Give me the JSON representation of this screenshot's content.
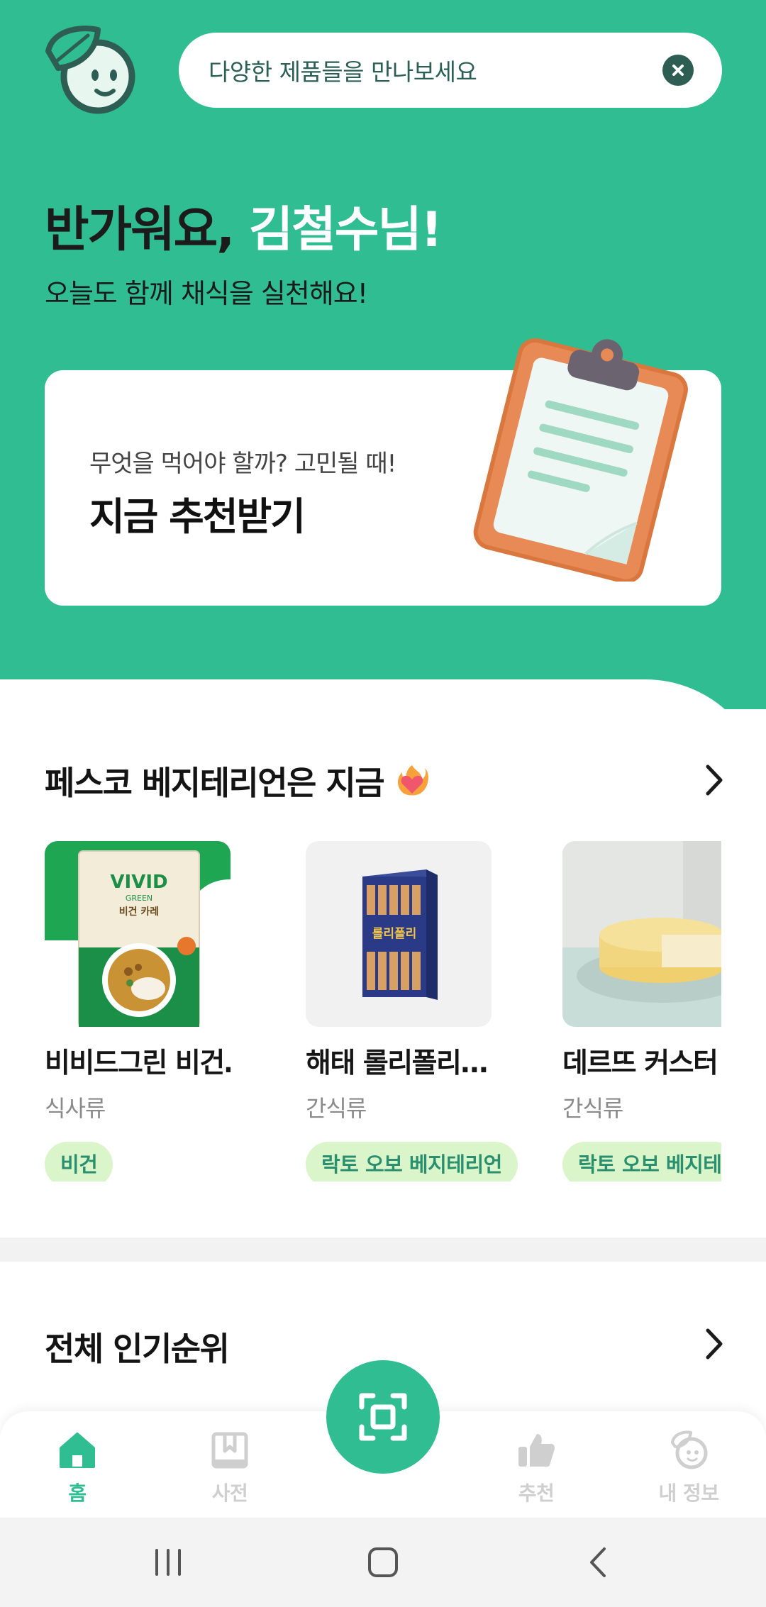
{
  "header": {
    "search_placeholder": "다양한 제품들을 만나보세요"
  },
  "greeting": {
    "prefix": "반가워요, ",
    "name": "김철수님!",
    "subtitle": "오늘도 함께 채식을 실천해요!"
  },
  "recommend_card": {
    "subtitle": "무엇을 먹어야 할까? 고민될 때!",
    "title": "지금 추천받기"
  },
  "section_pesco": {
    "title": "페스코 베지테리언은 지금",
    "products": [
      {
        "name": "비비드그린 비건…",
        "category": "식사류",
        "tag": "비건",
        "package_brand": "VIVID",
        "package_sub": "GREEN",
        "package_label": "비건 카레"
      },
      {
        "name": "해태 롤리폴리…",
        "category": "간식류",
        "tag": "락토 오보 베지테리언",
        "package_label": "롤리폴리"
      },
      {
        "name": "데르뜨 커스터",
        "category": "간식류",
        "tag": "락토 오보 베지테"
      }
    ]
  },
  "section_popular": {
    "title": "전체 인기순위"
  },
  "bottom_nav": {
    "items": [
      {
        "label": "홈",
        "icon": "home-icon",
        "active": true
      },
      {
        "label": "사전",
        "icon": "book-icon",
        "active": false
      },
      {
        "label": "추천",
        "icon": "thumbs-up-icon",
        "active": false
      },
      {
        "label": "내 정보",
        "icon": "profile-icon",
        "active": false
      }
    ],
    "fab_icon": "scan-icon"
  },
  "colors": {
    "brand_green": "#2fbd91",
    "tag_bg": "#d9f5c9",
    "tag_text": "#2a8f6e"
  }
}
